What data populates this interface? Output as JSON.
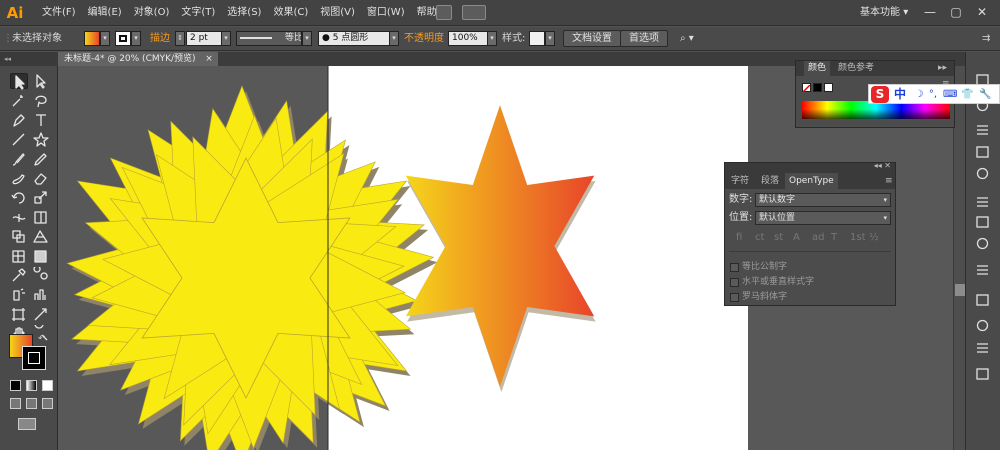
{
  "app": {
    "logo": "Ai"
  },
  "menu": {
    "items": [
      "文件(F)",
      "编辑(E)",
      "对象(O)",
      "文字(T)",
      "选择(S)",
      "效果(C)",
      "视图(V)",
      "窗口(W)",
      "帮助(H)"
    ],
    "workspace": "基本功能",
    "window_controls": {
      "minimize": "—",
      "restore": "▢",
      "close": "✕"
    }
  },
  "control_bar": {
    "selection_label": "未选择对象",
    "stroke_label": "描边",
    "stroke_weight": "2 pt",
    "stroke_profile": "等比",
    "brush_label": "● 5 点圆形",
    "opacity_label": "不透明度",
    "opacity_value": "100%",
    "style_label": "样式:",
    "doc_setup_button": "文档设置",
    "preferences_button": "首选项",
    "dropdown_arrow": "▾"
  },
  "document": {
    "tab_title": "未标题-4* @ 20% (CMYK/预览)",
    "close_glyph": "×"
  },
  "color_panel": {
    "tabs": [
      "颜色",
      "颜色参考"
    ],
    "menu_glyph": "≡",
    "collapse_glyph": "▸▸"
  },
  "ime": {
    "logo": "S",
    "mode": "中",
    "icons": [
      "☽",
      "°,",
      "⌨",
      "👕",
      "🔧"
    ]
  },
  "opentype_panel": {
    "tabs": [
      "字符",
      "段落",
      "OpenType"
    ],
    "menu_glyph": "≡",
    "top_controls": "◂◂  ✕",
    "numbers_label": "数字:",
    "numbers_value": "默认数字",
    "position_label": "位置:",
    "position_value": "默认位置",
    "glyph_buttons": [
      "fi",
      "ct",
      "st",
      "A",
      "ad",
      "T",
      "1st",
      "½"
    ],
    "checkboxes": [
      "等比公制字",
      "水平或垂直样式字",
      "罗马斜体字"
    ]
  },
  "colors": {
    "accent_orange": "#f59a23",
    "star_yellow": "#f9ea12",
    "gradient_start": "#f5d51a",
    "gradient_end": "#e8452a",
    "artboard": "#ffffff",
    "canvas": "#585858"
  }
}
